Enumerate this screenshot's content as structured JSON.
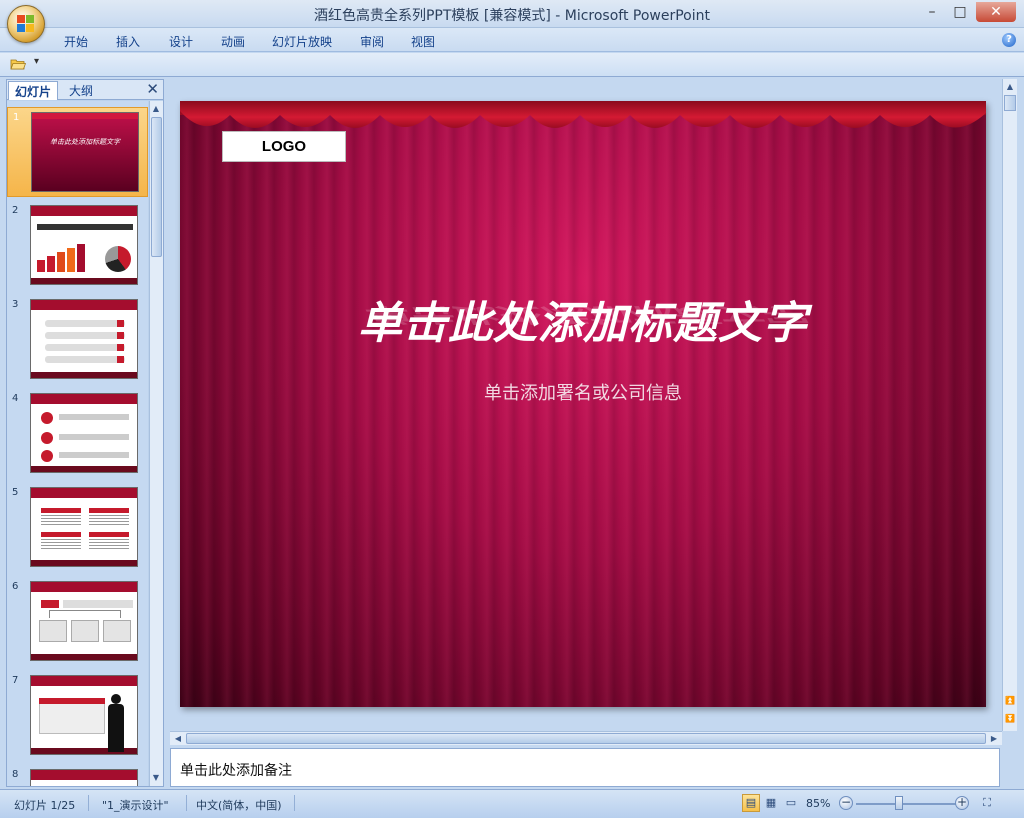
{
  "window": {
    "title": "酒红色高贵全系列PPT模板 [兼容模式] - Microsoft PowerPoint",
    "minimize": "–",
    "maximize": "□",
    "close": "✕"
  },
  "ribbon": {
    "tabs": [
      "开始",
      "插入",
      "设计",
      "动画",
      "幻灯片放映",
      "审阅",
      "视图"
    ],
    "help": "?"
  },
  "qat": {
    "dropdown": "▾"
  },
  "panel": {
    "tab_slides": "幻灯片",
    "tab_outline": "大纲",
    "close": "✕"
  },
  "thumbnails": [
    {
      "number": "1",
      "selected": true,
      "title": "单击此处添加标题文字"
    },
    {
      "number": "2",
      "selected": false
    },
    {
      "number": "3",
      "selected": false
    },
    {
      "number": "4",
      "selected": false
    },
    {
      "number": "5",
      "selected": false
    },
    {
      "number": "6",
      "selected": false
    },
    {
      "number": "7",
      "selected": false
    },
    {
      "number": "8",
      "selected": false
    }
  ],
  "slide": {
    "logo": "LOGO",
    "title": "单击此处添加标题文字",
    "subtitle": "单击添加署名或公司信息"
  },
  "notes": {
    "placeholder": "单击此处添加备注"
  },
  "status": {
    "slide_info": "幻灯片 1/25",
    "theme": "\"1_演示设计\"",
    "language": "中文(简体，中国)",
    "zoom": "85%",
    "zoom_out": "−",
    "zoom_in": "+"
  },
  "colors": {
    "slide_red": "#a10c44",
    "curtain_red": "#c0102e",
    "selected_thumb": "#f5b54a"
  }
}
